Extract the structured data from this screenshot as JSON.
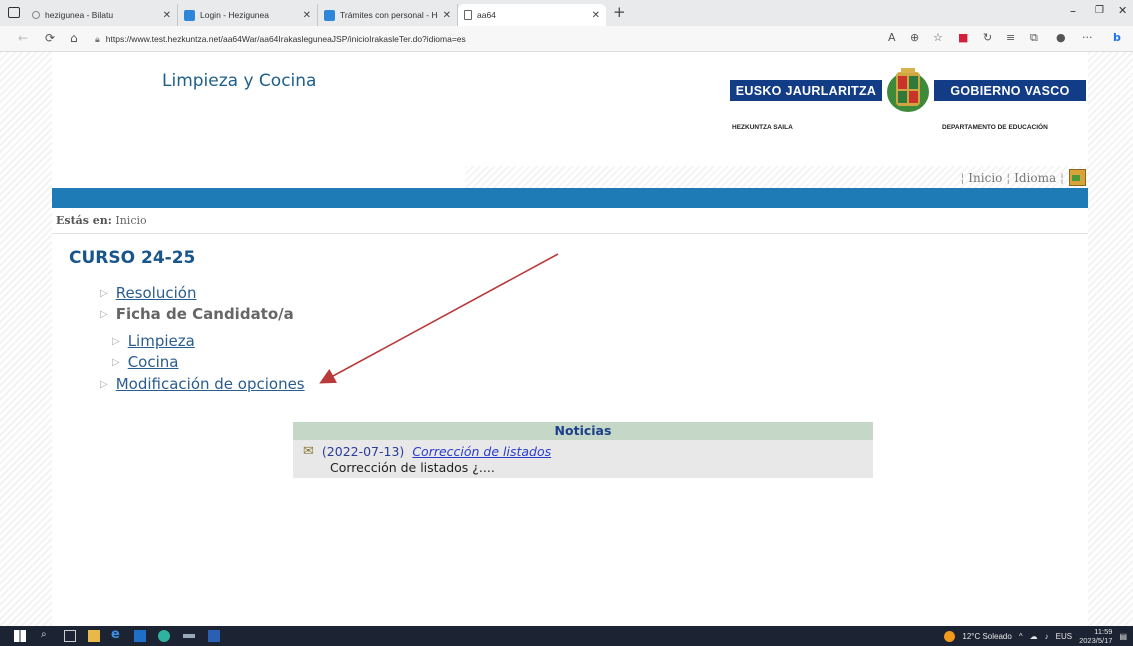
{
  "browser": {
    "tabs": [
      {
        "title": "hezigunea - Bilatu"
      },
      {
        "title": "Login - Hezigunea"
      },
      {
        "title": "Trámites con personal - Hezigun"
      },
      {
        "title": "aa64"
      }
    ],
    "new_tab": "+",
    "url": "https://www.test.hezkuntza.net/aa64War/aa64IrakasleguneaJSP/inicioIrakasleTer.do?idioma=es"
  },
  "header": {
    "site_title": "Limpieza y Cocina",
    "logo": {
      "left_band": "EUSKO JAURLARITZA",
      "right_band": "GOBIERNO VASCO",
      "left_sub": "HEZKUNTZA SAILA",
      "right_sub": "DEPARTAMENTO DE EDUCACIÓN"
    },
    "links": {
      "sep": "¦",
      "inicio": "Inicio",
      "idioma": "Idioma"
    }
  },
  "breadcrumb": {
    "prefix": "Estás en:",
    "current": "Inicio"
  },
  "main": {
    "course_title": "CURSO 24-25",
    "menu": {
      "resolucion": "Resolución",
      "ficha": "Ficha de Candidato/a",
      "limpieza": "Limpieza",
      "cocina": "Cocina",
      "modificacion": "Modificación de opciones"
    }
  },
  "news": {
    "header": "Noticias",
    "items": [
      {
        "date": "(2022-07-13)",
        "title": "Corrección de listados",
        "summary": "Corrección de listados ¿...."
      }
    ]
  },
  "taskbar": {
    "weather": "12°C Soleado",
    "lang": "EUS",
    "time": "11:59",
    "date": "2023/5/17"
  },
  "colors": {
    "accent_blue": "#1f7bb5",
    "title_blue": "#17558a",
    "news_header_bg": "#c5d8c8",
    "arrow": "#b83a3a"
  }
}
